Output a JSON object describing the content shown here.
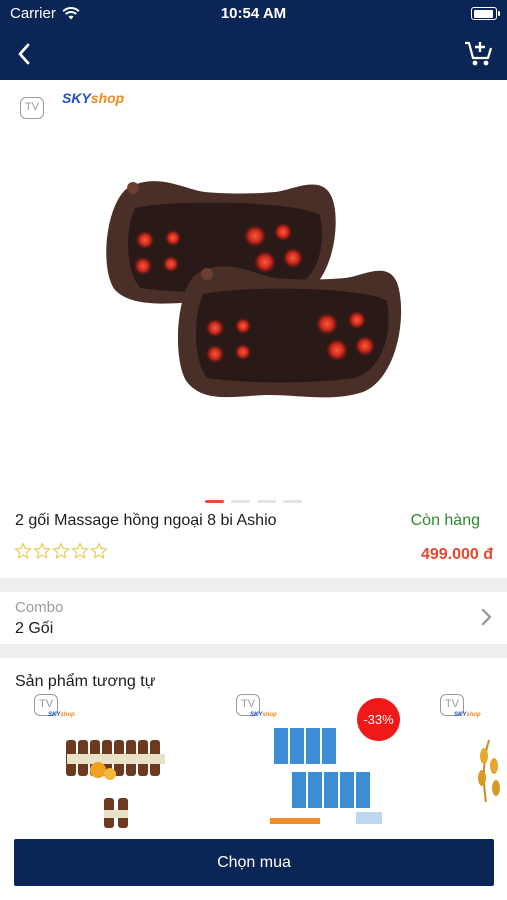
{
  "status_bar": {
    "carrier": "Carrier",
    "time": "10:54 AM"
  },
  "nav": {
    "back_icon": "chevron-left-icon",
    "cart_icon": "add-to-cart-icon"
  },
  "brand": {
    "logo_part1": "SKY",
    "logo_part2": "shop",
    "tv_badge": "TV"
  },
  "product": {
    "name": "2 gối Massage hồng ngoại 8 bi Ashio",
    "stock_status": "Còn hàng",
    "price": "499.000 đ",
    "rating_stars": 0,
    "rating_max": 5,
    "image_count": 4,
    "current_image": 1
  },
  "combo": {
    "label": "Combo",
    "value": "2 Gối"
  },
  "similar": {
    "title": "Sản phẩm tương tự",
    "items": [
      {
        "tv_badge": "TV",
        "discount": ""
      },
      {
        "tv_badge": "TV",
        "discount": "-33%"
      },
      {
        "tv_badge": "TV",
        "discount": ""
      }
    ]
  },
  "cta": {
    "buy_label": "Chọn mua"
  },
  "colors": {
    "navy": "#0b2556",
    "price_red": "#e8472f",
    "stock_green": "#2c8a2c",
    "star_gold": "#e8c64a"
  }
}
